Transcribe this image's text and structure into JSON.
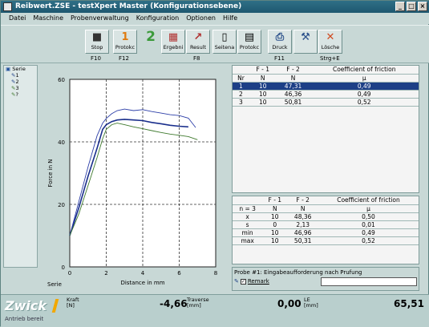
{
  "window": {
    "title": "Reibwert.ZSE - testXpert Master (Konfigurationsebene)",
    "controls": [
      "_",
      "□",
      "×"
    ]
  },
  "menu": [
    "Datei",
    "Maschine",
    "Probenverwaltung",
    "Konfiguration",
    "Optionen",
    "Hilfe"
  ],
  "toolbar": {
    "buttons": [
      {
        "label": "Stop",
        "icon": "stop-icon",
        "glyph": "S"
      },
      {
        "label": "Protokc",
        "icon": "number-one-icon",
        "glyph": "1"
      },
      {
        "label": "",
        "icon": "number-two-icon",
        "glyph": "2"
      },
      {
        "label": "Ergebni",
        "icon": "results-icon",
        "glyph": "▦"
      },
      {
        "label": "Result",
        "icon": "result-graph-icon",
        "glyph": "↗"
      },
      {
        "label": "Seitena",
        "icon": "page-icon",
        "glyph": "▯"
      },
      {
        "label": "Protokc",
        "icon": "report-icon",
        "glyph": "▤"
      },
      {
        "label": "Druck",
        "icon": "print-icon",
        "glyph": "⎙"
      },
      {
        "label": "",
        "icon": "tools-icon",
        "glyph": "⚒"
      },
      {
        "label": "Lösche",
        "icon": "delete-icon",
        "glyph": "✕"
      }
    ],
    "keys": [
      "F10",
      "F12",
      "F8",
      "F11",
      "Strg+E"
    ]
  },
  "tree": {
    "root": "Serie",
    "items": [
      "1",
      "2",
      "3",
      "?"
    ]
  },
  "chart_data": {
    "type": "line",
    "xlabel": "Distance in mm",
    "ylabel": "Force in N",
    "xlim": [
      0,
      8
    ],
    "ylim": [
      0,
      60
    ],
    "x_ticks": [
      0,
      2,
      4,
      6,
      8
    ],
    "y_ticks": [
      0,
      20,
      40,
      60
    ],
    "grid": true,
    "corner_label": "Serie",
    "series": [
      {
        "color": "#1a2f8c",
        "points": [
          [
            0,
            10
          ],
          [
            0.5,
            19
          ],
          [
            1,
            29
          ],
          [
            1.5,
            38
          ],
          [
            1.8,
            44
          ],
          [
            2,
            45.5
          ],
          [
            2.3,
            46.5
          ],
          [
            2.6,
            47
          ],
          [
            3,
            47.2
          ],
          [
            3.5,
            47
          ],
          [
            4,
            46.8
          ],
          [
            4.5,
            46.2
          ],
          [
            5,
            45.8
          ],
          [
            5.5,
            45.3
          ],
          [
            6,
            45
          ],
          [
            6.5,
            44.8
          ]
        ]
      },
      {
        "color": "#2d3fa8",
        "points": [
          [
            0,
            10
          ],
          [
            0.5,
            21
          ],
          [
            1,
            32
          ],
          [
            1.5,
            42
          ],
          [
            1.8,
            46
          ],
          [
            2,
            47.5
          ],
          [
            2.3,
            49
          ],
          [
            2.6,
            50
          ],
          [
            3,
            50.5
          ],
          [
            3.5,
            50
          ],
          [
            4,
            50.3
          ],
          [
            4.5,
            49.7
          ],
          [
            5,
            49.2
          ],
          [
            5.5,
            48.7
          ],
          [
            6,
            48.4
          ],
          [
            6.5,
            47.6
          ],
          [
            6.9,
            44.6
          ]
        ]
      },
      {
        "color": "#3f7a2e",
        "points": [
          [
            0,
            10
          ],
          [
            0.5,
            17
          ],
          [
            1,
            26
          ],
          [
            1.5,
            35
          ],
          [
            1.8,
            41
          ],
          [
            2,
            44
          ],
          [
            2.3,
            45.5
          ],
          [
            2.6,
            46
          ],
          [
            3,
            45.5
          ],
          [
            3.5,
            44.8
          ],
          [
            4,
            44.2
          ],
          [
            4.5,
            43.6
          ],
          [
            5,
            43
          ],
          [
            5.5,
            42.5
          ],
          [
            6,
            42.1
          ],
          [
            6.5,
            41.7
          ],
          [
            7,
            40.7
          ]
        ]
      }
    ]
  },
  "table1": {
    "headers": [
      "",
      "F - 1",
      "F - 2",
      "Coefficient of friction"
    ],
    "units": [
      "Nr",
      "N",
      "N",
      "μ"
    ],
    "rows": [
      [
        "1",
        "10",
        "47,31",
        "0,49"
      ],
      [
        "2",
        "10",
        "46,36",
        "0,49"
      ],
      [
        "3",
        "10",
        "50,81",
        "0,52"
      ]
    ]
  },
  "table2": {
    "headers": [
      "",
      "F - 1",
      "F - 2",
      "Coefficient of friction"
    ],
    "units": [
      "n = 3",
      "N",
      "N",
      "μ"
    ],
    "rows": [
      [
        "x",
        "10",
        "48,36",
        "0,50"
      ],
      [
        "s",
        "0",
        "2,13",
        "0,01"
      ],
      [
        "min",
        "10",
        "46,96",
        "0,49"
      ],
      [
        "max",
        "10",
        "50,31",
        "0,52"
      ]
    ]
  },
  "prompt": {
    "title": "Probe #1: Eingabeaufforderung nach Prufung",
    "checkbox_label": "Remark",
    "checked": true
  },
  "statusbar": {
    "logo": "Zwick",
    "status": "Antrieb bereit",
    "fields": [
      {
        "label1": "Kraft",
        "label2": "[N]",
        "value": "-4,66"
      },
      {
        "label1": "Traverse",
        "label2": "[mm]",
        "value": "0,00"
      },
      {
        "label1": "LE",
        "label2": "[mm]",
        "value": "65,51"
      }
    ]
  }
}
